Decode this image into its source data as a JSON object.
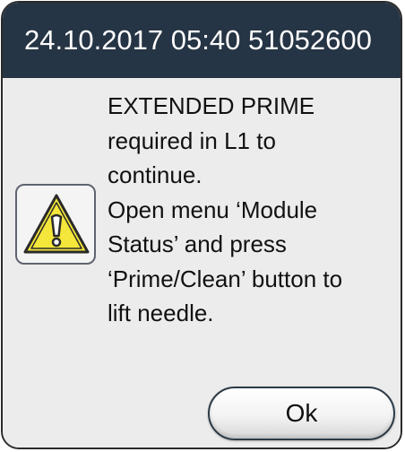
{
  "titlebar": {
    "text": "24.10.2017 05:40  51052600"
  },
  "message": {
    "icon": "warning-triangle-icon",
    "text": "EXTENDED PRIME\nrequired in L1 to\ncontinue.\nOpen menu ‘Module\nStatus’ and press\n‘Prime/Clean’ button to\nlift needle."
  },
  "buttons": {
    "ok_label": "Ok"
  },
  "colors": {
    "titlebar_bg": "#263545",
    "dialog_bg": "#ececec",
    "warning_yellow": "#f4e63a"
  }
}
